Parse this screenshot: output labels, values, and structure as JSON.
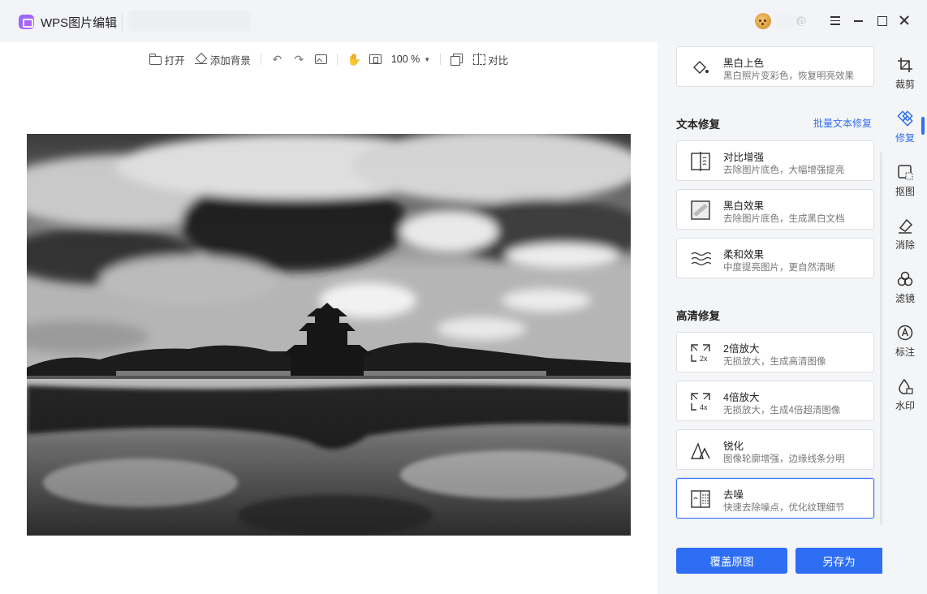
{
  "app": {
    "title": "WPS图片编辑"
  },
  "window": {
    "icons": [
      "menu-icon",
      "minimize-icon",
      "maximize-icon",
      "close-icon"
    ]
  },
  "toolbar": {
    "open_label": "打开",
    "add_bg_label": "添加背景",
    "zoom_value": "100 %",
    "compare_label": "对比"
  },
  "panel": {
    "colorize": {
      "title": "黑白上色",
      "desc": "黑白照片变彩色，恢复明亮效果"
    },
    "text_repair": {
      "title": "文本修复",
      "batch_link": "批量文本修复",
      "items": [
        {
          "title": "对比增强",
          "desc": "去除图片底色，大幅增强提亮"
        },
        {
          "title": "黑白效果",
          "desc": "去除图片底色，生成黑白文档"
        },
        {
          "title": "柔和效果",
          "desc": "中度提亮图片，更自然清晰"
        }
      ]
    },
    "hd_repair": {
      "title": "高清修复",
      "items": [
        {
          "title": "2倍放大",
          "desc": "无损放大，生成高清图像",
          "tag": "2x"
        },
        {
          "title": "4倍放大",
          "desc": "无损放大，生成4倍超清图像",
          "tag": "4x"
        },
        {
          "title": "锐化",
          "desc": "图像轮廓增强，边缘线条分明"
        },
        {
          "title": "去噪",
          "desc": "快速去除噪点，优化纹理细节"
        }
      ]
    },
    "buttons": {
      "cover": "覆盖原图",
      "save_as": "另存为"
    }
  },
  "sidenav": {
    "items": [
      {
        "label": "裁剪",
        "icon": "crop-icon"
      },
      {
        "label": "修复",
        "icon": "repair-icon",
        "active": true
      },
      {
        "label": "抠图",
        "icon": "cutout-icon"
      },
      {
        "label": "消除",
        "icon": "eraser-icon"
      },
      {
        "label": "滤镜",
        "icon": "filter-icon"
      },
      {
        "label": "标注",
        "icon": "annotate-icon"
      },
      {
        "label": "水印",
        "icon": "watermark-icon"
      }
    ]
  },
  "colors": {
    "accent": "#2d6ef5",
    "panel_bg": "#f4f5f7"
  }
}
